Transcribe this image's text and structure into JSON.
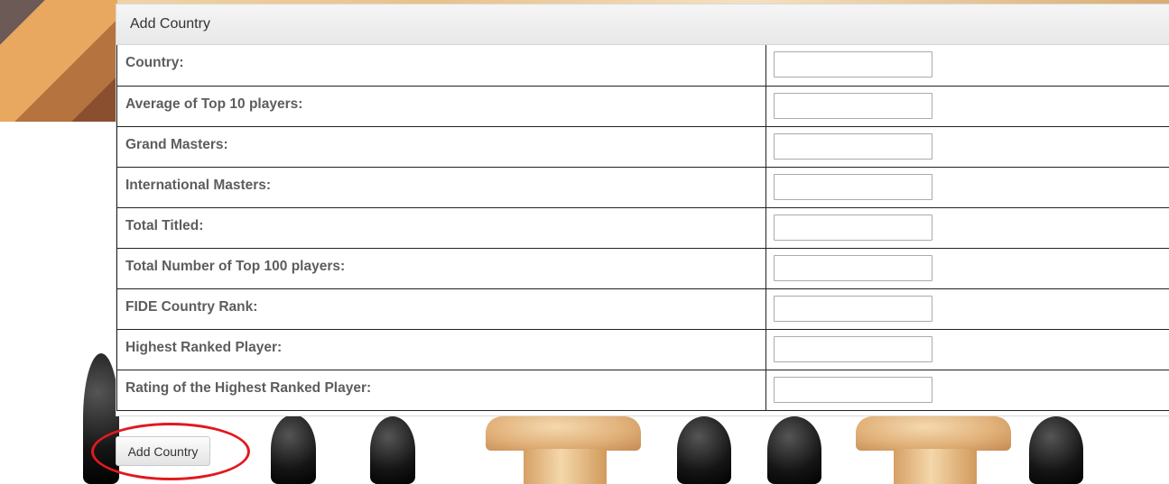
{
  "panel": {
    "title": "Add Country"
  },
  "form": {
    "rows": [
      {
        "label": "Country:",
        "value": ""
      },
      {
        "label": "Average of Top 10 players:",
        "value": ""
      },
      {
        "label": "Grand Masters:",
        "value": ""
      },
      {
        "label": "International Masters:",
        "value": ""
      },
      {
        "label": "Total Titled:",
        "value": ""
      },
      {
        "label": "Total Number of Top 100 players:",
        "value": ""
      },
      {
        "label": "FIDE Country Rank:",
        "value": ""
      },
      {
        "label": "Highest Ranked Player:",
        "value": ""
      },
      {
        "label": "Rating of the Highest Ranked Player:",
        "value": ""
      }
    ]
  },
  "actions": {
    "submit_label": "Add Country"
  },
  "colors": {
    "highlight": "#e0191f",
    "label_text": "#5d5d5d"
  }
}
